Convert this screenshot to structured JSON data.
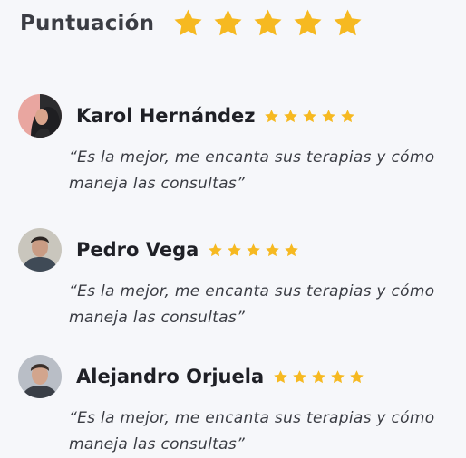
{
  "rating": {
    "title": "Puntuación",
    "stars": 5,
    "star_color": "#f6b921"
  },
  "reviews": [
    {
      "name": "Karol Hernández",
      "stars": 5,
      "text": "“Es la mejor, me encanta sus terapias y cómo maneja las consultas”"
    },
    {
      "name": "Pedro Vega",
      "stars": 5,
      "text": "“Es la mejor, me encanta sus terapias y cómo maneja las consultas”"
    },
    {
      "name": "Alejandro Orjuela",
      "stars": 5,
      "text": "“Es la mejor, me encanta sus terapias y cómo maneja las consultas”"
    }
  ]
}
